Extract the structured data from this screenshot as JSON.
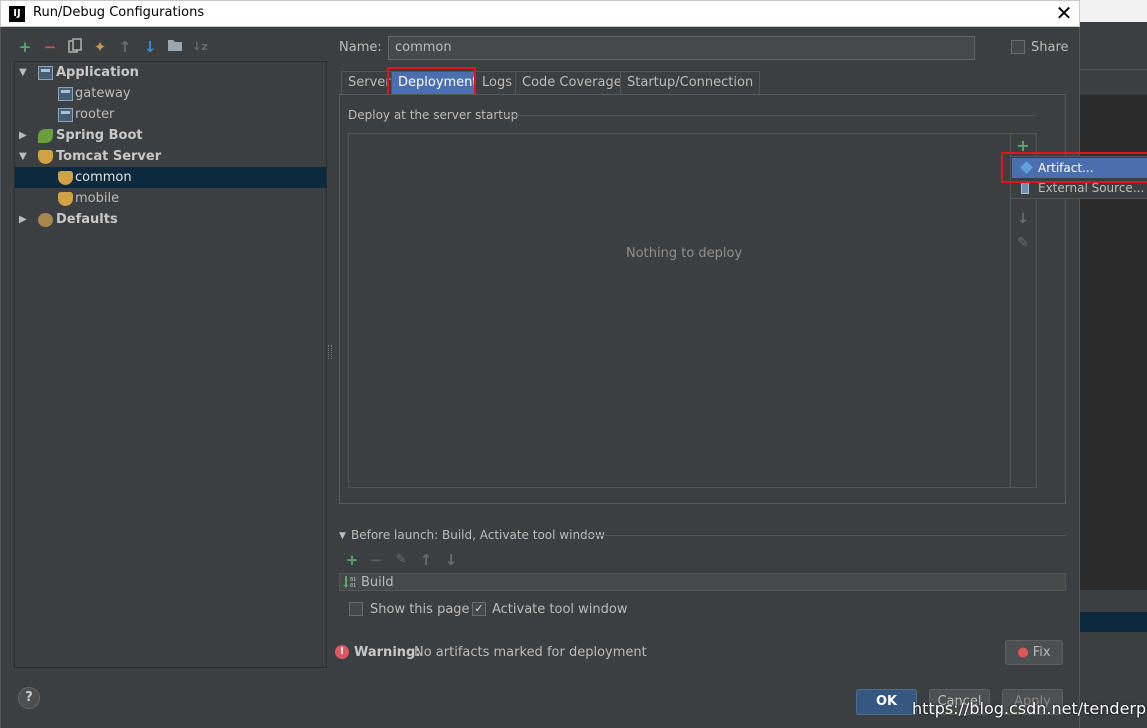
{
  "window": {
    "title": "Run/Debug Configurations",
    "logo": "IJ"
  },
  "left_toolbar": [
    "add-icon",
    "remove-icon",
    "copy-icon",
    "edit-defaults-icon",
    "move-up-icon",
    "move-down-icon",
    "folder-icon",
    "sort-icon"
  ],
  "tree": [
    {
      "label": "Application",
      "bold": true,
      "expanded": true
    },
    {
      "label": "gateway"
    },
    {
      "label": "rooter"
    },
    {
      "label": "Spring Boot",
      "bold": true,
      "expanded": false
    },
    {
      "label": "Tomcat Server",
      "bold": true,
      "expanded": true
    },
    {
      "label": "common",
      "selected": true
    },
    {
      "label": "mobile"
    },
    {
      "label": "Defaults",
      "bold": true,
      "expanded": false
    }
  ],
  "name": {
    "label": "Name:",
    "value": "common"
  },
  "share": {
    "label": "Share",
    "checked": false
  },
  "tabs": [
    "Server",
    "Deployment",
    "Logs",
    "Code Coverage",
    "Startup/Connection"
  ],
  "active_tab": "Deployment",
  "deployment": {
    "section_title": "Deploy at the server startup",
    "empty_text": "Nothing to deploy",
    "add_glyph": "+"
  },
  "popup": {
    "items": [
      "Artifact...",
      "External Source..."
    ]
  },
  "before_launch": {
    "label": "Before launch: Build, Activate tool window",
    "items": [
      "Build"
    ],
    "show_page_label": "Show this page",
    "show_page_checked": false,
    "activate_label": "Activate tool window",
    "activate_checked": true
  },
  "warning": {
    "bold": "Warning:",
    "text": "No artifacts marked for deployment",
    "fix_label": "Fix"
  },
  "buttons": {
    "ok": "OK",
    "cancel": "Cancel",
    "apply": "Apply",
    "help": "?"
  },
  "watermark": "https://blog.csdn.net/tenderpuss",
  "colors": {
    "accent": "#4b6eaf",
    "selection": "#0d293e",
    "highlight_box": "#e0151a",
    "add_green": "#59a869",
    "remove_red": "#c75450"
  }
}
